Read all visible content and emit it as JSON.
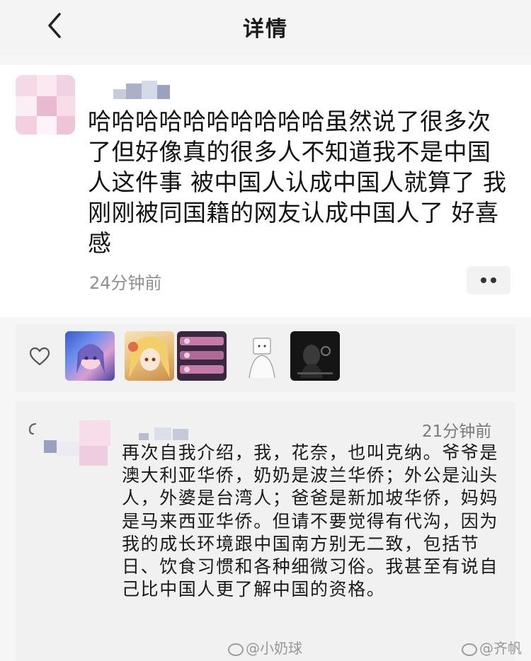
{
  "header": {
    "title": "详情",
    "back_icon": "chevron-left-icon"
  },
  "post": {
    "text": "哈哈哈哈哈哈哈哈哈哈虽然说了很多次了但好像真的很多人不知道我不是中国人这件事 被中国人认成中国人就算了 我刚刚被同国籍的网友认成中国人了 好喜感",
    "time": "24分钟前",
    "more_icon": "more-dots-icon"
  },
  "likes": {
    "heart_icon": "heart-outline-icon",
    "avatars": [
      "anime-girl-blue",
      "anime-girl-blonde",
      "striped-banner",
      "sketch-girl-white",
      "dark-photo"
    ]
  },
  "comment": {
    "time": "21分钟前",
    "text": "再次自我介绍，我，花奈，也叫克纳。爷爷是澳大利亚华侨，奶奶是波兰华侨；外公是汕头人，外婆是台湾人；爸爸是新加坡华侨，妈妈是马来西亚华侨。但请不要觉得有代沟，因为我的成长环境跟中国南方别无二致，包括节日、饮食习惯和各种细微习俗。我甚至有说自己比中国人更了解中国的资格。"
  },
  "watermarks": {
    "left": "@小奶球",
    "right": "@齐帆"
  },
  "colors": {
    "background": "#f6f6f6",
    "card": "#ffffff",
    "panel": "#f1f1f1",
    "muted_text": "#8f8f8f"
  }
}
